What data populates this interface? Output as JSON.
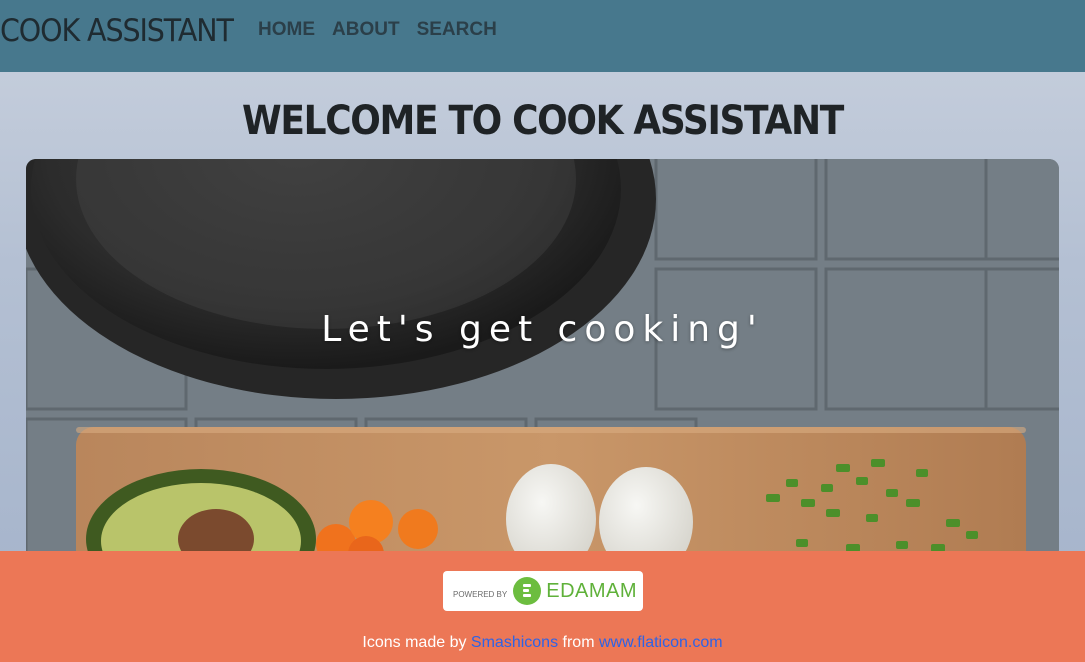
{
  "navbar": {
    "brand": "COOK ASSISTANT",
    "links": [
      "HOME",
      "ABOUT",
      "SEARCH"
    ]
  },
  "main": {
    "heading": "WELCOME TO COOK ASSISTANT",
    "hero_tagline": "Let's get cooking'"
  },
  "footer": {
    "badge": {
      "powered_by": "POWERED BY",
      "brand": "EDAMAM"
    },
    "credits": {
      "prefix": "Icons made by",
      "author": "Smashicons",
      "middle": "from",
      "site": "www.flaticon.com"
    }
  },
  "colors": {
    "navbar": "#47788d",
    "footer": "#ec7756",
    "link": "#2e63e6",
    "edamam_green": "#6cbd3f"
  }
}
